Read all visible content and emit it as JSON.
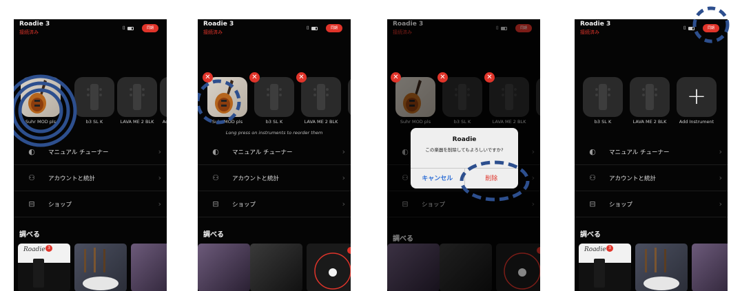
{
  "header": {
    "title": "Roadie 3",
    "status": "接続済み",
    "button_label": "同期"
  },
  "instruments": [
    {
      "label": "Suhr MOD pls",
      "icon": "guitar-photo"
    },
    {
      "label": "b3 SL K",
      "icon": "guitar-headstock-icon"
    },
    {
      "label": "LAVA ME 2 BLK",
      "icon": "guitar-headstock-icon"
    },
    {
      "label": "Add Instrument",
      "icon": "plus-icon"
    }
  ],
  "hint": "Long press on instruments to reorder them",
  "menu": [
    {
      "label": "マニュアル チューナー",
      "icon": "tuner-icon"
    },
    {
      "label": "アカウントと統計",
      "icon": "user-icon"
    },
    {
      "label": "ショップ",
      "icon": "cart-icon"
    }
  ],
  "explore": {
    "title": "調べる",
    "roadie_logo": "Roadie",
    "badge": "3"
  },
  "dialog": {
    "title": "Roadie",
    "message": "この楽器を削除してもよろしいですか?",
    "cancel": "キャンセル",
    "delete": "削除"
  },
  "colors": {
    "accent_red": "#e0342a",
    "annotation_blue": "#2d4f8e",
    "background": "#050505"
  }
}
